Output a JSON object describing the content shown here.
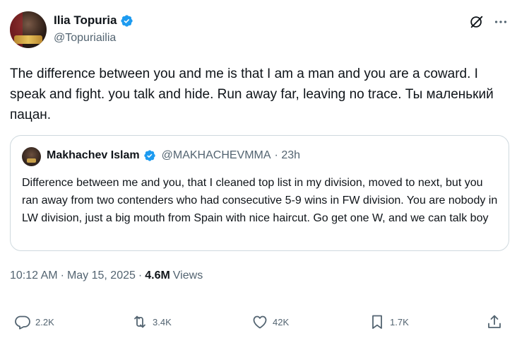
{
  "author": {
    "display_name": "Ilia Topuria",
    "handle": "@Topuriailia"
  },
  "tweet": {
    "text": "The difference between you and me is that I am a man and you are a coward. I speak and fight. you talk and hide. Run away far, leaving no trace. Ты маленький пацан."
  },
  "quote": {
    "display_name": "Makhachev Islam",
    "handle": "@MAKHACHEVMMA",
    "time": "· 23h",
    "text": "Difference between me and you, that I cleaned top list in my division, moved to next, but you ran away from two contenders who had consecutive 5-9 wins in FW division. You are nobody in LW division, just a big mouth from Spain with nice haircut. Go get one W, and we can talk boy"
  },
  "meta": {
    "time": "10:12 AM",
    "sep1": "·",
    "date": "May 15, 2025",
    "sep2": "·",
    "views_count": "4.6M",
    "views_label": "Views"
  },
  "actions": {
    "replies": "2.2K",
    "reposts": "3.4K",
    "likes": "42K",
    "bookmarks": "1.7K"
  },
  "icons": [
    "verified-icon",
    "grok-icon",
    "more-icon",
    "reply-icon",
    "repost-icon",
    "like-icon",
    "bookmark-icon",
    "share-icon"
  ],
  "colors": {
    "verified": "#1d9bf0",
    "secondary_text": "#536471",
    "primary_text": "#0f1419",
    "border": "#cfd9de"
  }
}
